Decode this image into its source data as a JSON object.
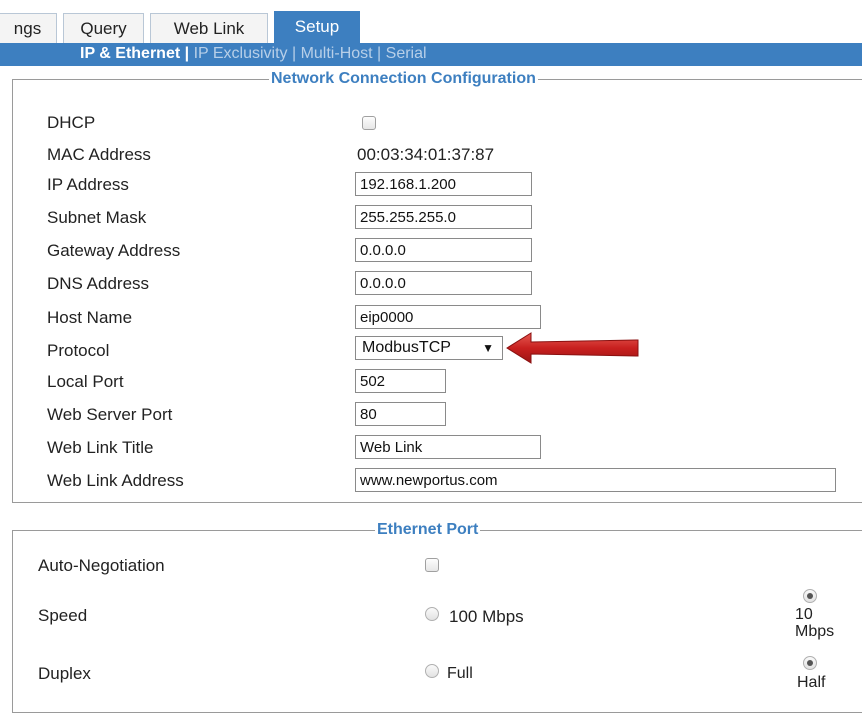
{
  "tabs": [
    {
      "label": "ngs"
    },
    {
      "label": "Query"
    },
    {
      "label": "Web Link"
    },
    {
      "label": "Setup",
      "active": true
    }
  ],
  "subnav": {
    "current": "IP & Ethernet",
    "sep": "|",
    "links": [
      "IP Exclusivity",
      "Multi-Host",
      "Serial"
    ]
  },
  "network": {
    "legend": "Network Connection Configuration",
    "dhcp_label": "DHCP",
    "mac_label": "MAC Address",
    "mac_value": "00:03:34:01:37:87",
    "ip_label": "IP Address",
    "ip_value": "192.168.1.200",
    "subnet_label": "Subnet Mask",
    "subnet_value": "255.255.255.0",
    "gateway_label": "Gateway Address",
    "gateway_value": "0.0.0.0",
    "dns_label": "DNS Address",
    "dns_value": "0.0.0.0",
    "host_label": "Host Name",
    "host_value": "eip0000",
    "protocol_label": "Protocol",
    "protocol_value": "ModbusTCP",
    "local_port_label": "Local Port",
    "local_port_value": "502",
    "web_port_label": "Web Server Port",
    "web_port_value": "80",
    "web_title_label": "Web Link Title",
    "web_title_value": "Web Link",
    "web_address_label": "Web Link Address",
    "web_address_value": "www.newportus.com"
  },
  "ethernet": {
    "legend": "Ethernet Port",
    "autoneg_label": "Auto-Negotiation",
    "speed_label": "Speed",
    "speed_100": "100 Mbps",
    "speed_10_a": "10",
    "speed_10_b": "Mbps",
    "duplex_label": "Duplex",
    "duplex_full": "Full",
    "duplex_half": "Half"
  },
  "colors": {
    "accent": "#3d7fc0",
    "arrow": "#c8201f"
  },
  "icons": {
    "caret": "dropdown-caret-icon",
    "arrow": "red-arrow-icon"
  }
}
